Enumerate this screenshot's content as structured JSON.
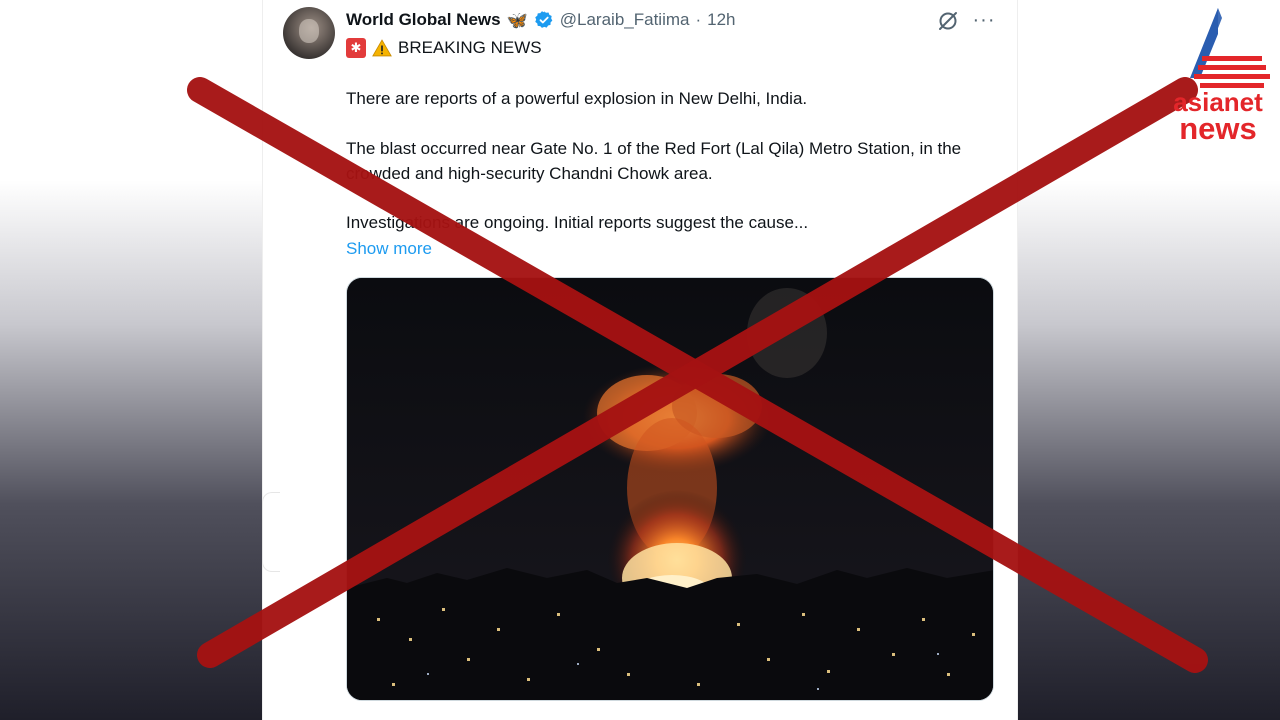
{
  "tweet": {
    "author_name": "World Global News",
    "handle": "@Laraib_Fatiima",
    "separator": "·",
    "time": "12h",
    "badge_icon": "butterfly-icon",
    "verified_icon": "verified-badge-icon",
    "headline": "BREAKING NEWS",
    "paragraphs": {
      "p1": "There are reports of a powerful explosion in New Delhi, India.",
      "p2": "The blast occurred near Gate No. 1 of the Red Fort (Lal Qila) Metro Station, in the crowded and high-security Chandni Chowk area.",
      "p3": "Investigations are ongoing. Initial reports suggest the cause..."
    },
    "show_more": "Show more",
    "media": "night-explosion-photo"
  },
  "watermark": {
    "line1": "asianet",
    "line2": "news"
  },
  "colors": {
    "link": "#1d9bf0",
    "cross": "#a51212",
    "logo_red": "#e3262a",
    "logo_blue": "#2a5db0"
  }
}
